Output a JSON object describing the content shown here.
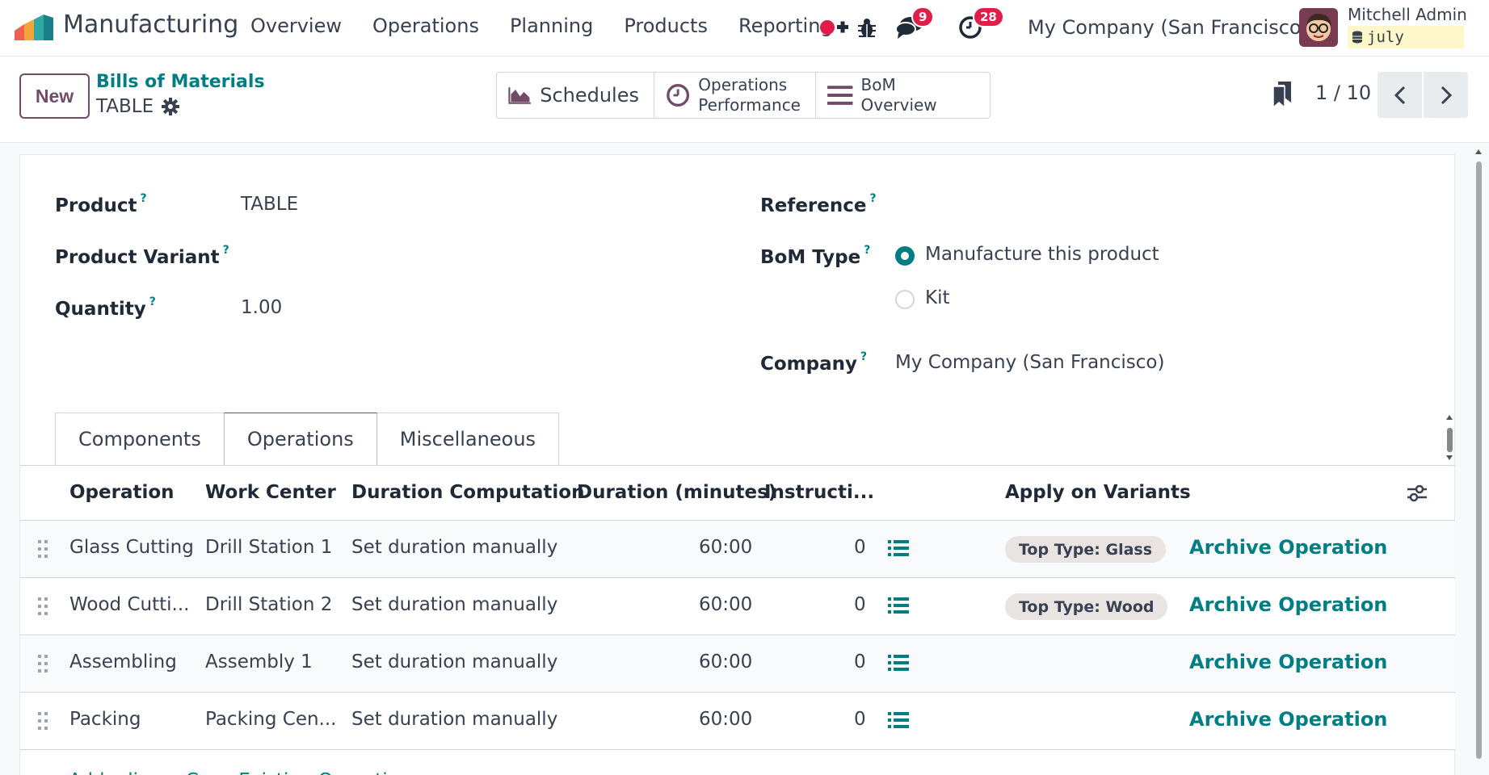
{
  "app": {
    "name": "Manufacturing",
    "menu": [
      "Overview",
      "Operations",
      "Planning",
      "Products",
      "Reporting"
    ],
    "messages_count": "9",
    "activities_count": "28",
    "company": "My Company (San Francisco)",
    "user_name": "Mitchell Admin",
    "database": "july"
  },
  "control": {
    "new_label": "New",
    "breadcrumb": "Bills of Materials",
    "record_name": "TABLE",
    "smart_buttons": {
      "schedules": "Schedules",
      "ops_perf_line1": "Operations",
      "ops_perf_line2": "Performance",
      "bom_overview": "BoM Overview"
    },
    "pager": "1 / 10"
  },
  "form": {
    "product_label": "Product",
    "product_value": "TABLE",
    "variant_label": "Product Variant",
    "quantity_label": "Quantity",
    "quantity_value": "1.00",
    "reference_label": "Reference",
    "bom_type_label": "BoM Type",
    "bom_type_options": [
      "Manufacture this product",
      "Kit"
    ],
    "bom_type_selected": "Manufacture this product",
    "company_label": "Company",
    "company_value": "My Company (San Francisco)",
    "help_mark": "?"
  },
  "tabs": [
    "Components",
    "Operations",
    "Miscellaneous"
  ],
  "active_tab": "Operations",
  "operations": {
    "columns": [
      "Operation",
      "Work Center",
      "Duration Computation",
      "Duration (minutes)",
      "Instructi...",
      "Apply on Variants"
    ],
    "rows": [
      {
        "operation": "Glass Cutting",
        "work_center": "Drill Station 1",
        "computation": "Set duration manually",
        "duration": "60:00",
        "instructions": "0",
        "variant": "Top Type: Glass",
        "action": "Archive Operation"
      },
      {
        "operation": "Wood Cutti...",
        "work_center": "Drill Station 2",
        "computation": "Set duration manually",
        "duration": "60:00",
        "instructions": "0",
        "variant": "Top Type: Wood",
        "action": "Archive Operation"
      },
      {
        "operation": "Assembling",
        "work_center": "Assembly 1",
        "computation": "Set duration manually",
        "duration": "60:00",
        "instructions": "0",
        "variant": "",
        "action": "Archive Operation"
      },
      {
        "operation": "Packing",
        "work_center": "Packing Cen...",
        "computation": "Set duration manually",
        "duration": "60:00",
        "instructions": "0",
        "variant": "",
        "action": "Archive Operation"
      }
    ],
    "add_line": "Add a line",
    "copy_existing": "Copy Existing Operations"
  },
  "colors": {
    "brand": "#714b67",
    "accent": "#017e84",
    "badge": "#e11d48",
    "tag_bg": "#e9e3e1"
  },
  "icons": [
    "manufacturing-logo-icon",
    "phone-plus-icon",
    "bug-icon",
    "chat-icon",
    "clock-icon",
    "gear-icon",
    "area-chart-icon",
    "clock-circle-icon",
    "list-bars-icon",
    "bookmark-icon",
    "chevron-left-icon",
    "chevron-right-icon",
    "drag-handle-icon",
    "list-icon",
    "sliders-icon",
    "database-icon"
  ]
}
